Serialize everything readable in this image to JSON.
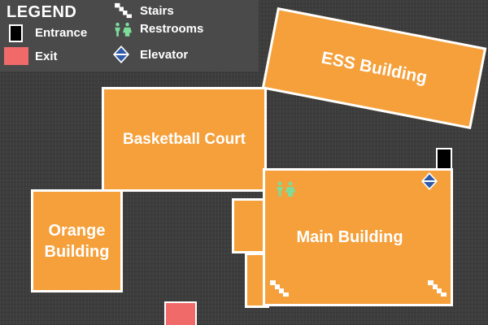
{
  "legend": {
    "title": "LEGEND",
    "items": {
      "entrance": "Entrance",
      "exit": "Exit",
      "stairs": "Stairs",
      "restrooms": "Restrooms",
      "elevator": "Elevator"
    }
  },
  "buildings": {
    "ess": "ESS Building",
    "basketball": "Basketball Court",
    "orange": "Orange\nBuilding",
    "main": "Main Building"
  },
  "icons": {
    "stairs": "stairs-icon",
    "restrooms": "restroom-icon",
    "elevator": "elevator-icon",
    "entrance": "entrance-marker",
    "exit": "exit-marker"
  },
  "colors": {
    "background": "#3d3d3d",
    "building_fill": "#f5a03b",
    "building_border": "#ffffff",
    "entrance": "#000000",
    "exit": "#f06a6a",
    "restroom": "#7ddc9a",
    "elevator": "#2f5aa8"
  }
}
